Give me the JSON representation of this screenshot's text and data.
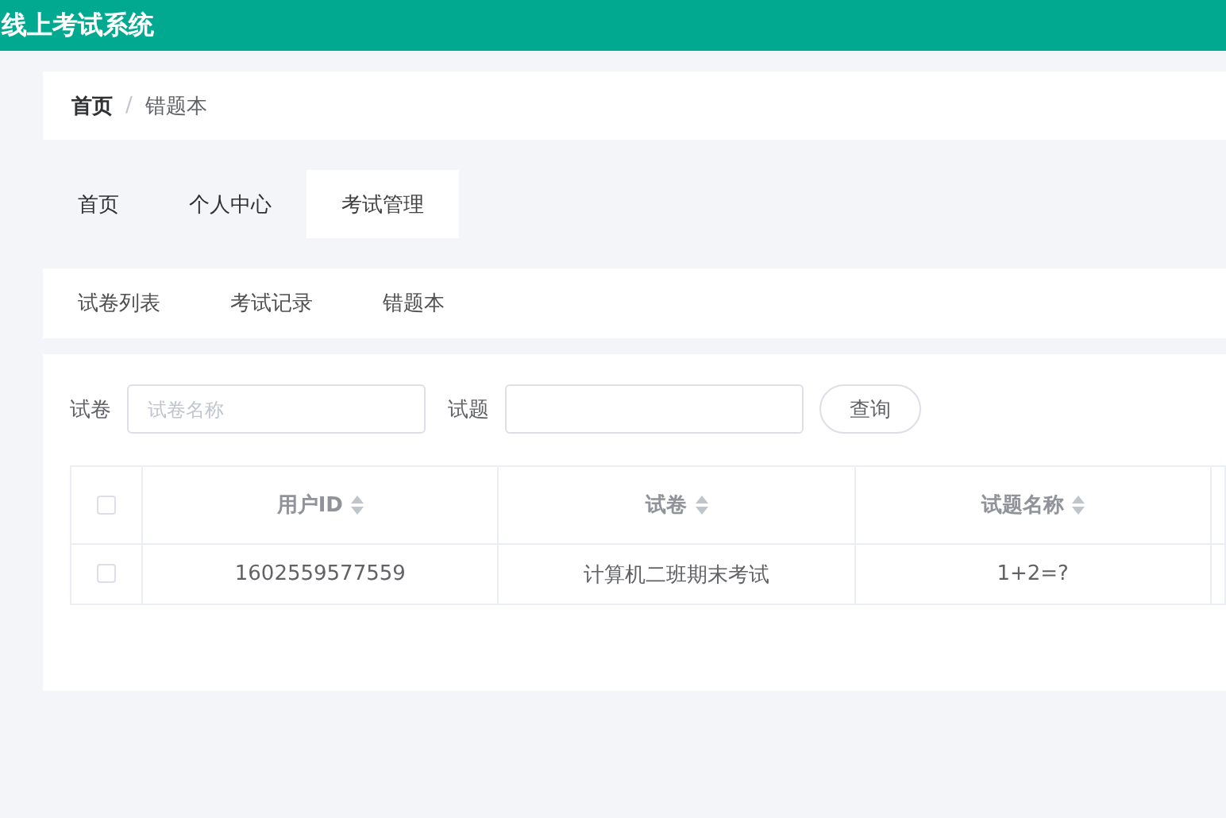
{
  "header": {
    "title": "线上考试系统"
  },
  "breadcrumb": [
    {
      "label": "首页",
      "current": false
    },
    {
      "label": "错题本",
      "current": true
    }
  ],
  "breadcrumb_separator": "/",
  "main_tabs": [
    {
      "label": "首页",
      "selected": false
    },
    {
      "label": "个人中心",
      "selected": false
    },
    {
      "label": "考试管理",
      "selected": true
    }
  ],
  "sub_tabs": [
    {
      "label": "试卷列表"
    },
    {
      "label": "考试记录"
    },
    {
      "label": "错题本"
    }
  ],
  "search": {
    "fields": [
      {
        "label": "试卷",
        "placeholder": "试卷名称"
      },
      {
        "label": "试题"
      }
    ],
    "button": "查询"
  },
  "table": {
    "columns": [
      {
        "label": "用户ID"
      },
      {
        "label": "试卷"
      },
      {
        "label": "试题名称"
      }
    ],
    "rows": [
      {
        "checked": false,
        "cells": [
          "1602559577559",
          "计算机二班期末考试",
          "1+2=?"
        ]
      }
    ],
    "all_checked": false
  }
}
